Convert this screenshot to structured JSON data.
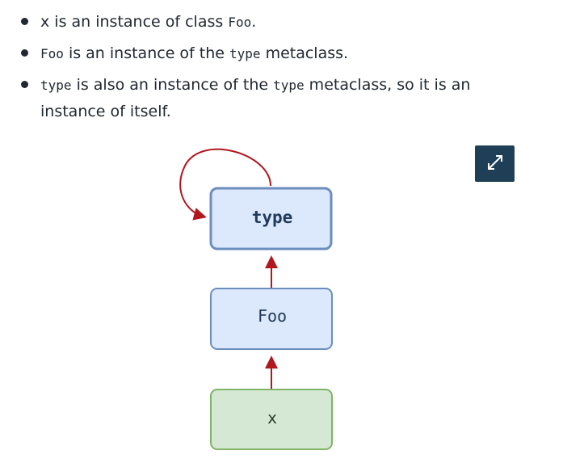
{
  "bullets": [
    {
      "parts": [
        "x",
        " is an instance of class ",
        "Foo",
        "."
      ]
    },
    {
      "parts": [
        "Foo",
        " is an instance of the ",
        "type",
        " metaclass."
      ]
    },
    {
      "parts": [
        "type",
        " is also an instance of the ",
        "type",
        " metaclass, so it is an",
        "instance of itself."
      ]
    }
  ],
  "expand_icon": "expand-arrows-icon",
  "diagram": {
    "nodes": {
      "type": "type",
      "foo": "Foo",
      "x": "x"
    }
  },
  "colors": {
    "arrow": "#b0171e",
    "type_fill": "#dce8fb",
    "type_stroke": "#6c8ebf",
    "foo_fill": "#dce8fb",
    "foo_stroke": "#6c8ebf",
    "x_fill": "#d5e8d4",
    "x_stroke": "#82b366",
    "button": "#1f3f57"
  }
}
